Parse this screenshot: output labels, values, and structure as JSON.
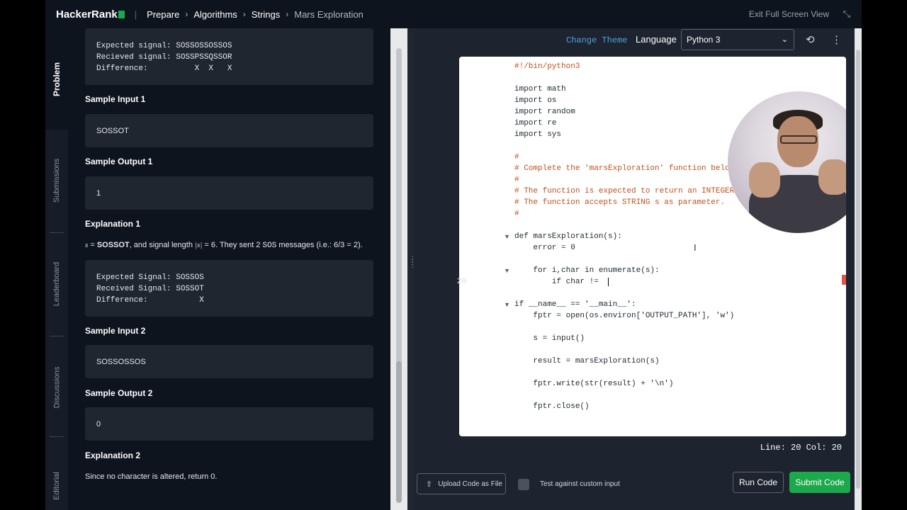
{
  "topbar": {
    "logo": "HackerRank",
    "breadcrumbs": [
      "Prepare",
      "Algorithms",
      "Strings",
      "Mars Exploration"
    ],
    "exit_label": "Exit Full Screen View"
  },
  "tabs": [
    "Problem",
    "Submissions",
    "Leaderboard",
    "Discussions",
    "Editorial"
  ],
  "problem": {
    "pre0": "Expected signal: SOSSOSSOSSOS\nRecieved signal: SOSSPSSQSSOR\nDifference:          X  X   X",
    "sample_input_1_label": "Sample Input 1",
    "sample_input_1": "SOSSOT",
    "sample_output_1_label": "Sample Output 1",
    "sample_output_1": "1",
    "explanation_1_label": "Explanation 1",
    "explanation_1": {
      "s_var": "s",
      "eq1": " = ",
      "s_val": "SOSSOT",
      "mid1": ", and signal length ",
      "len_expr": "|s|",
      "mid2": " = 6. They sent 2 ",
      "sos": "SOS",
      "mid3": " messages (i.e.: 6/3 = 2)."
    },
    "pre1": "Expected Signal: SOSSOS\nReceived Signal: SOSSOT\nDifference:           X",
    "sample_input_2_label": "Sample Input 2",
    "sample_input_2": "SOSSOSSOS",
    "sample_output_2_label": "Sample Output 2",
    "sample_output_2": "0",
    "explanation_2_label": "Explanation 2",
    "explanation_2": "Since no character is altered, return 0."
  },
  "editor": {
    "change_theme": "Change Theme",
    "language_label": "Language",
    "language": "Python 3",
    "current_line_number": "20",
    "status": "Line: 20  Col: 20",
    "code_lines": [
      "#!/bin/python3",
      "",
      "import math",
      "import os",
      "import random",
      "import re",
      "import sys",
      "",
      "#",
      "# Complete the 'marsExploration' function below.",
      "#",
      "# The function is expected to return an INTEGER.",
      "# The function accepts STRING s as parameter.",
      "#",
      "",
      "def marsExploration(s):",
      "    error = 0",
      "",
      "    for i,char in enumerate(s):",
      "        if char != ",
      "",
      "if __name__ == '__main__':",
      "    fptr = open(os.environ['OUTPUT_PATH'], 'w')",
      "",
      "    s = input()",
      "",
      "    result = marsExploration(s)",
      "",
      "    fptr.write(str(result) + '\\n')",
      "",
      "    fptr.close()"
    ]
  },
  "bottom": {
    "upload_label": "Upload Code as File",
    "custom_input_label": "Test against custom input",
    "run_label": "Run Code",
    "submit_label": "Submit Code"
  },
  "colors": {
    "brand_green": "#1ba94c",
    "link_blue": "#4aa3df",
    "background": "#0e141e"
  },
  "icons": [
    "chevron-right-icon",
    "exit-fullscreen-icon",
    "history-icon",
    "more-vertical-icon",
    "upload-icon",
    "chevron-down-icon",
    "fold-arrow-icon"
  ]
}
